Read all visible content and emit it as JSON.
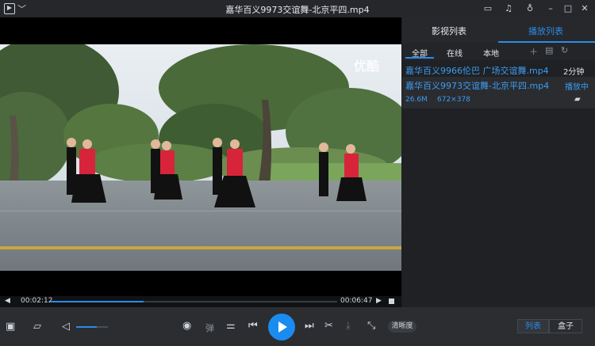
{
  "window": {
    "title": "嘉华百义9973交谊舞-北京平四.mp4",
    "menu_chevron": "﹀",
    "controls": [
      "screen-icon",
      "bell-icon",
      "shirt-icon",
      "minimize-icon",
      "maximize-icon",
      "close-icon"
    ]
  },
  "video": {
    "watermark": "优酷"
  },
  "panel": {
    "tabs": [
      {
        "label": "影视列表",
        "active": false
      },
      {
        "label": "播放列表",
        "active": true
      }
    ],
    "filters": [
      {
        "label": "全部",
        "active": true
      },
      {
        "label": "在线",
        "active": false
      },
      {
        "label": "本地",
        "active": false
      }
    ],
    "playlist": [
      {
        "name": "嘉华百义9966伦巴 广场交谊舞.mp4",
        "status": "2分钟",
        "playing": false
      },
      {
        "name": "嘉华百义9973交谊舞-北京平四.mp4",
        "status": "播放中",
        "playing": true
      }
    ],
    "detail": {
      "size": "26.6M",
      "resolution": "672×378"
    }
  },
  "player": {
    "current_time": "00:02:12",
    "total_time": "00:06:47",
    "progress": 0.325,
    "volume": 0.65,
    "danmaku_label": "弹",
    "quality_label": "清晰度",
    "view_list_label": "列表",
    "view_box_label": "盒子"
  },
  "colors": {
    "accent": "#2b8be8",
    "background": "#1e1f21"
  }
}
